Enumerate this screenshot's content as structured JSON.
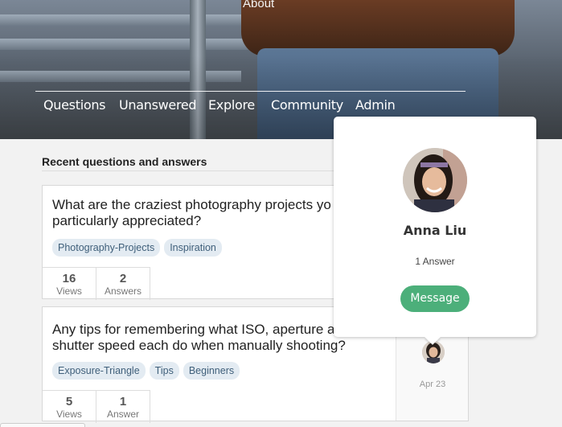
{
  "header": {
    "about_label": "About"
  },
  "nav": {
    "items": [
      "Questions",
      "Unanswered",
      "Explore",
      "Community",
      "Admin"
    ]
  },
  "section": {
    "title": "Recent questions and answers"
  },
  "questions": [
    {
      "text_line1": "What are the craziest photography projects yo",
      "text_line2": "particularly appreciated?",
      "tags": [
        "Photography-Projects",
        "Inspiration"
      ],
      "views": "16",
      "views_label": "Views",
      "answers": "2",
      "answers_label": "Answers"
    },
    {
      "text_line1": "Any tips for remembering what ISO, aperture a",
      "text_line2": "shutter speed each do when manually shooting?",
      "tags": [
        "Exposure-Triangle",
        "Tips",
        "Beginners"
      ],
      "views": "5",
      "views_label": "Views",
      "answers": "1",
      "answers_label": "Answer",
      "date": "Apr 23"
    }
  ],
  "popup": {
    "name": "Anna Liu",
    "answers": "1 Answer",
    "message_label": "Message"
  },
  "colors": {
    "accent_green": "#4caf7a",
    "tag_bg": "#e3ebf2",
    "tag_text": "#3f5f7a"
  }
}
